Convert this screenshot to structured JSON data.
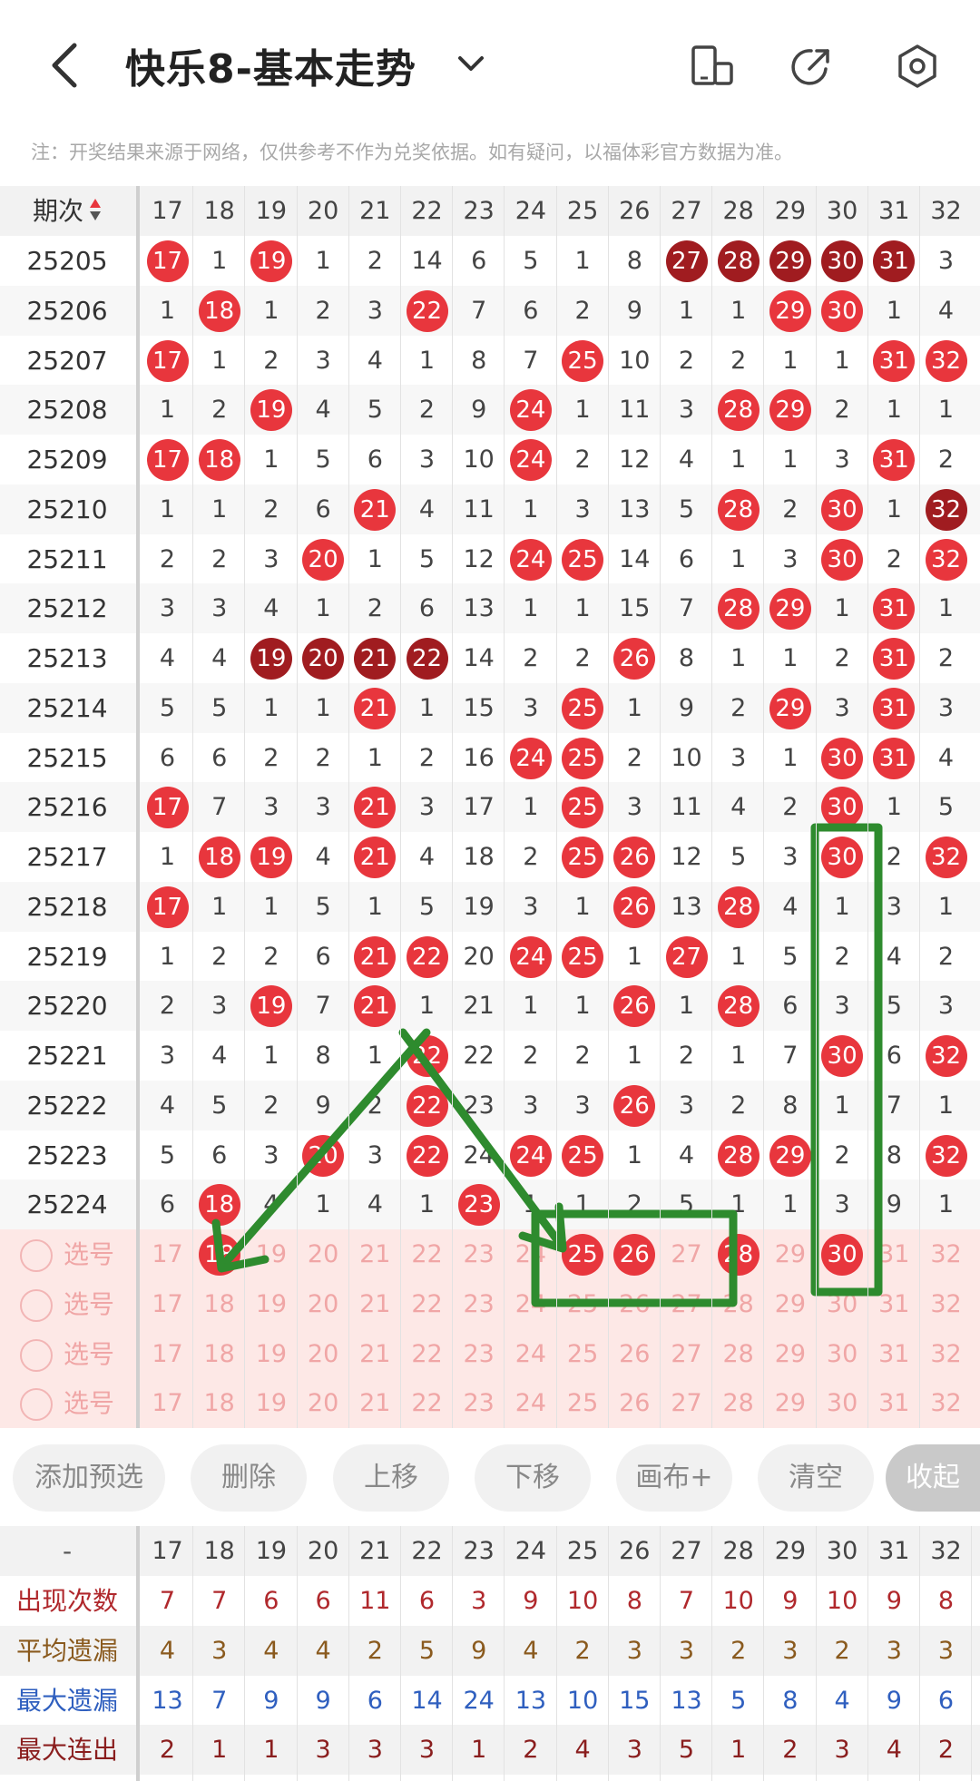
{
  "header": {
    "title": "快乐8-基本走势",
    "note": "注：开奖结果来源于网络，仅供参考不作为兑奖依据。如有疑问，以福体彩官方数据为准。"
  },
  "table": {
    "period_label": "期次",
    "columns": [
      "17",
      "18",
      "19",
      "20",
      "21",
      "22",
      "23",
      "24",
      "25",
      "26",
      "27",
      "28",
      "29",
      "30",
      "31",
      "32"
    ],
    "rows": [
      {
        "period": "25205",
        "cells": [
          "17",
          "1",
          "19",
          "1",
          "2",
          "14",
          "6",
          "5",
          "1",
          "8",
          "27",
          "28",
          "29",
          "30",
          "31",
          "3"
        ],
        "hits": [
          0,
          2,
          10,
          11,
          12,
          13,
          14
        ],
        "dark": [
          10,
          11,
          12,
          13,
          14
        ]
      },
      {
        "period": "25206",
        "cells": [
          "1",
          "18",
          "1",
          "2",
          "3",
          "22",
          "7",
          "6",
          "2",
          "9",
          "1",
          "1",
          "29",
          "30",
          "1",
          "4"
        ],
        "hits": [
          1,
          5,
          12,
          13
        ],
        "dark": []
      },
      {
        "period": "25207",
        "cells": [
          "17",
          "1",
          "2",
          "3",
          "4",
          "1",
          "8",
          "7",
          "25",
          "10",
          "2",
          "2",
          "1",
          "1",
          "31",
          "32"
        ],
        "hits": [
          0,
          8,
          14,
          15
        ],
        "dark": []
      },
      {
        "period": "25208",
        "cells": [
          "1",
          "2",
          "19",
          "4",
          "5",
          "2",
          "9",
          "24",
          "1",
          "11",
          "3",
          "28",
          "29",
          "2",
          "1",
          "1"
        ],
        "hits": [
          2,
          7,
          11,
          12
        ],
        "dark": []
      },
      {
        "period": "25209",
        "cells": [
          "17",
          "18",
          "1",
          "5",
          "6",
          "3",
          "10",
          "24",
          "2",
          "12",
          "4",
          "1",
          "1",
          "3",
          "31",
          "2"
        ],
        "hits": [
          0,
          1,
          7,
          14
        ],
        "dark": []
      },
      {
        "period": "25210",
        "cells": [
          "1",
          "1",
          "2",
          "6",
          "21",
          "4",
          "11",
          "1",
          "3",
          "13",
          "5",
          "28",
          "2",
          "30",
          "1",
          "32"
        ],
        "hits": [
          4,
          11,
          13,
          15
        ],
        "dark": [
          15
        ]
      },
      {
        "period": "25211",
        "cells": [
          "2",
          "2",
          "3",
          "20",
          "1",
          "5",
          "12",
          "24",
          "25",
          "14",
          "6",
          "1",
          "3",
          "30",
          "2",
          "32"
        ],
        "hits": [
          3,
          7,
          8,
          13,
          15
        ],
        "dark": []
      },
      {
        "period": "25212",
        "cells": [
          "3",
          "3",
          "4",
          "1",
          "2",
          "6",
          "13",
          "1",
          "1",
          "15",
          "7",
          "28",
          "29",
          "1",
          "31",
          "1"
        ],
        "hits": [
          11,
          12,
          14
        ],
        "dark": []
      },
      {
        "period": "25213",
        "cells": [
          "4",
          "4",
          "19",
          "20",
          "21",
          "22",
          "14",
          "2",
          "2",
          "26",
          "8",
          "1",
          "1",
          "2",
          "31",
          "2"
        ],
        "hits": [
          2,
          3,
          4,
          5,
          9,
          14
        ],
        "dark": [
          2,
          3,
          4,
          5
        ]
      },
      {
        "period": "25214",
        "cells": [
          "5",
          "5",
          "1",
          "1",
          "21",
          "1",
          "15",
          "3",
          "25",
          "1",
          "9",
          "2",
          "29",
          "3",
          "31",
          "3"
        ],
        "hits": [
          4,
          8,
          12,
          14
        ],
        "dark": []
      },
      {
        "period": "25215",
        "cells": [
          "6",
          "6",
          "2",
          "2",
          "1",
          "2",
          "16",
          "24",
          "25",
          "2",
          "10",
          "3",
          "1",
          "30",
          "31",
          "4"
        ],
        "hits": [
          7,
          8,
          13,
          14
        ],
        "dark": []
      },
      {
        "period": "25216",
        "cells": [
          "17",
          "7",
          "3",
          "3",
          "21",
          "3",
          "17",
          "1",
          "25",
          "3",
          "11",
          "4",
          "2",
          "30",
          "1",
          "5"
        ],
        "hits": [
          0,
          4,
          8,
          13
        ],
        "dark": []
      },
      {
        "period": "25217",
        "cells": [
          "1",
          "18",
          "19",
          "4",
          "21",
          "4",
          "18",
          "2",
          "25",
          "26",
          "12",
          "5",
          "3",
          "30",
          "2",
          "32"
        ],
        "hits": [
          1,
          2,
          4,
          8,
          9,
          13,
          15
        ],
        "dark": []
      },
      {
        "period": "25218",
        "cells": [
          "17",
          "1",
          "1",
          "5",
          "1",
          "5",
          "19",
          "3",
          "1",
          "26",
          "13",
          "28",
          "4",
          "1",
          "3",
          "1"
        ],
        "hits": [
          0,
          9,
          11
        ],
        "dark": []
      },
      {
        "period": "25219",
        "cells": [
          "1",
          "2",
          "2",
          "6",
          "21",
          "22",
          "20",
          "24",
          "25",
          "1",
          "27",
          "1",
          "5",
          "2",
          "4",
          "2"
        ],
        "hits": [
          4,
          5,
          7,
          8,
          10
        ],
        "dark": []
      },
      {
        "period": "25220",
        "cells": [
          "2",
          "3",
          "19",
          "7",
          "21",
          "1",
          "21",
          "1",
          "1",
          "26",
          "1",
          "28",
          "6",
          "3",
          "5",
          "3"
        ],
        "hits": [
          2,
          4,
          9,
          11
        ],
        "dark": []
      },
      {
        "period": "25221",
        "cells": [
          "3",
          "4",
          "1",
          "8",
          "1",
          "22",
          "22",
          "2",
          "2",
          "1",
          "2",
          "1",
          "7",
          "30",
          "6",
          "32"
        ],
        "hits": [
          5,
          13,
          15
        ],
        "dark": []
      },
      {
        "period": "25222",
        "cells": [
          "4",
          "5",
          "2",
          "9",
          "2",
          "22",
          "23",
          "3",
          "3",
          "26",
          "3",
          "2",
          "8",
          "1",
          "7",
          "1"
        ],
        "hits": [
          5,
          9
        ],
        "dark": []
      },
      {
        "period": "25223",
        "cells": [
          "5",
          "6",
          "3",
          "20",
          "3",
          "22",
          "24",
          "24",
          "25",
          "1",
          "4",
          "28",
          "29",
          "2",
          "8",
          "32"
        ],
        "hits": [
          3,
          5,
          7,
          8,
          11,
          12,
          15
        ],
        "dark": []
      },
      {
        "period": "25224",
        "cells": [
          "6",
          "18",
          "4",
          "1",
          "4",
          "1",
          "23",
          "1",
          "1",
          "2",
          "5",
          "1",
          "1",
          "3",
          "9",
          "1"
        ],
        "hits": [
          1,
          6
        ],
        "dark": []
      }
    ],
    "pick_label": "选号",
    "pick_rows": [
      {
        "selected": [
          1,
          8,
          9,
          11,
          13
        ]
      },
      {
        "selected": []
      },
      {
        "selected": []
      },
      {
        "selected": []
      }
    ]
  },
  "buttons": {
    "add": "添加预选",
    "delete": "删除",
    "up": "上移",
    "down": "下移",
    "canvas": "画布+",
    "clear": "清空",
    "collapse": "收起"
  },
  "stats": {
    "dash": "-",
    "rows": [
      {
        "label": "出现次数",
        "color": "#b0282c",
        "values": [
          "7",
          "7",
          "6",
          "6",
          "11",
          "6",
          "3",
          "9",
          "10",
          "8",
          "7",
          "10",
          "9",
          "10",
          "9",
          "8"
        ]
      },
      {
        "label": "平均遗漏",
        "color": "#8a5a1e",
        "values": [
          "4",
          "3",
          "4",
          "4",
          "2",
          "5",
          "9",
          "4",
          "2",
          "3",
          "3",
          "2",
          "3",
          "2",
          "3",
          "3"
        ]
      },
      {
        "label": "最大遗漏",
        "color": "#2f5fbf",
        "values": [
          "13",
          "7",
          "9",
          "9",
          "6",
          "14",
          "24",
          "13",
          "10",
          "15",
          "13",
          "5",
          "8",
          "4",
          "9",
          "6"
        ]
      },
      {
        "label": "最大连出",
        "color": "#8a1e1e",
        "values": [
          "2",
          "1",
          "1",
          "3",
          "3",
          "3",
          "1",
          "2",
          "4",
          "3",
          "5",
          "1",
          "2",
          "3",
          "4",
          "2"
        ]
      }
    ]
  },
  "colors": {
    "ball": "#e8363d",
    "ball_dark": "#a01c20",
    "annotation": "#2e8b2e",
    "pick_bg": "#fde8e6",
    "pick_text": "#f0a6a6"
  }
}
